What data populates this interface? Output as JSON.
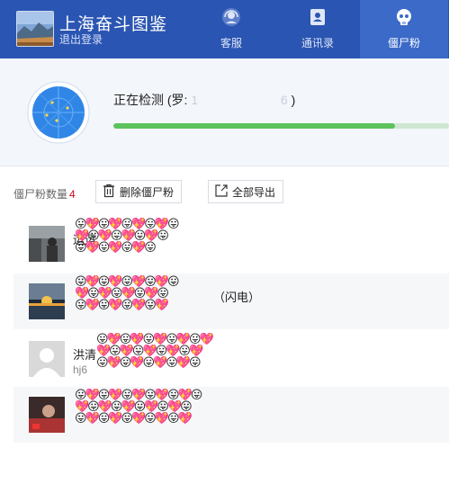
{
  "app": {
    "title": "上海奋斗图鉴",
    "logout_label": "退出登录"
  },
  "tabs": [
    {
      "label": "客服",
      "icon": "headset-icon",
      "active": false
    },
    {
      "label": "通讯录",
      "icon": "contacts-icon",
      "active": false
    },
    {
      "label": "僵尸粉",
      "icon": "skull-icon",
      "active": true
    }
  ],
  "detect": {
    "prefix": "正在检测 (罗:",
    "masked_start": "1",
    "masked_end": "6",
    "suffix": ")",
    "progress": 0.84
  },
  "toolbar": {
    "count_label": "僵尸粉数量",
    "count_value": "4",
    "delete_label": "删除僵尸粉",
    "export_label": "全部导出"
  },
  "list": [
    {
      "name": "运运",
      "sub": "",
      "extra": ""
    },
    {
      "name": "",
      "sub": "",
      "extra": "（闪电）"
    },
    {
      "name": "洪清",
      "sub": "hj6",
      "extra": ""
    },
    {
      "name": "",
      "sub": "",
      "extra": ""
    }
  ],
  "colors": {
    "header_bg": "#2a55b2",
    "active_tab_bg": "#3b6ac8",
    "progress_fill": "#5cc35c",
    "count_red": "#d0021b"
  }
}
